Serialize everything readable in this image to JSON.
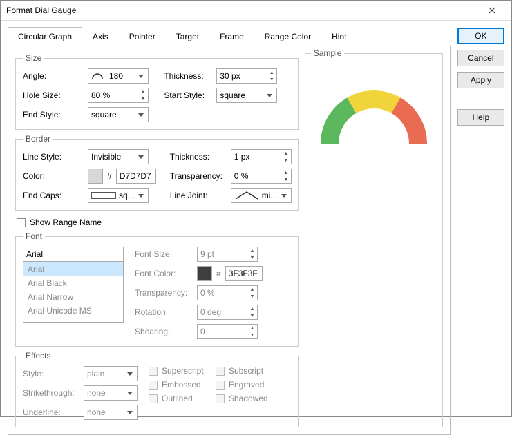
{
  "window": {
    "title": "Format Dial Gauge"
  },
  "buttons": {
    "ok": "OK",
    "cancel": "Cancel",
    "apply": "Apply",
    "help": "Help"
  },
  "tabs": [
    "Circular Graph",
    "Axis",
    "Pointer",
    "Target",
    "Frame",
    "Range Color",
    "Hint"
  ],
  "active_tab": 0,
  "size": {
    "legend": "Size",
    "angle_label": "Angle:",
    "angle_value": "180",
    "thickness_label": "Thickness:",
    "thickness_value": "30 px",
    "hole_label": "Hole Size:",
    "hole_value": "80 %",
    "start_style_label": "Start Style:",
    "start_style_value": "square",
    "end_style_label": "End Style:",
    "end_style_value": "square"
  },
  "border": {
    "legend": "Border",
    "line_style_label": "Line Style:",
    "line_style_value": "Invisible",
    "thickness_label": "Thickness:",
    "thickness_value": "1 px",
    "color_label": "Color:",
    "color_hash": "#",
    "color_value": "D7D7D7",
    "transparency_label": "Transparency:",
    "transparency_value": "0 %",
    "end_caps_label": "End Caps:",
    "end_caps_value": "sq...",
    "line_joint_label": "Line Joint:",
    "line_joint_value": "mi..."
  },
  "show_range_name_label": "Show Range Name",
  "font": {
    "legend": "Font",
    "search_value": "Arial",
    "options": [
      "Arial",
      "Arial Black",
      "Arial Narrow",
      "Arial Unicode MS"
    ],
    "selected_index": 0,
    "size_label": "Font Size:",
    "size_value": "9 pt",
    "color_label": "Font Color:",
    "color_hash": "#",
    "color_value": "3F3F3F",
    "transparency_label": "Transparency:",
    "transparency_value": "0 %",
    "rotation_label": "Rotation:",
    "rotation_value": "0 deg",
    "shearing_label": "Shearing:",
    "shearing_value": "0"
  },
  "effects": {
    "legend": "Effects",
    "style_label": "Style:",
    "style_value": "plain",
    "strike_label": "Strikethrough:",
    "strike_value": "none",
    "underline_label": "Underline:",
    "underline_value": "none",
    "superscript": "Superscript",
    "subscript": "Subscript",
    "embossed": "Embossed",
    "engraved": "Engraved",
    "outlined": "Outlined",
    "shadowed": "Shadowed"
  },
  "sample": {
    "legend": "Sample"
  },
  "chart_data": {
    "type": "pie",
    "subtype": "half-donut-gauge",
    "angle": 180,
    "hole_size_percent": 80,
    "thickness_px": 30,
    "segments": [
      {
        "name": "green",
        "color": "#5cb85c",
        "fraction": 0.333
      },
      {
        "name": "yellow",
        "color": "#f0d43a",
        "fraction": 0.334
      },
      {
        "name": "red",
        "color": "#e86b52",
        "fraction": 0.333
      }
    ]
  }
}
